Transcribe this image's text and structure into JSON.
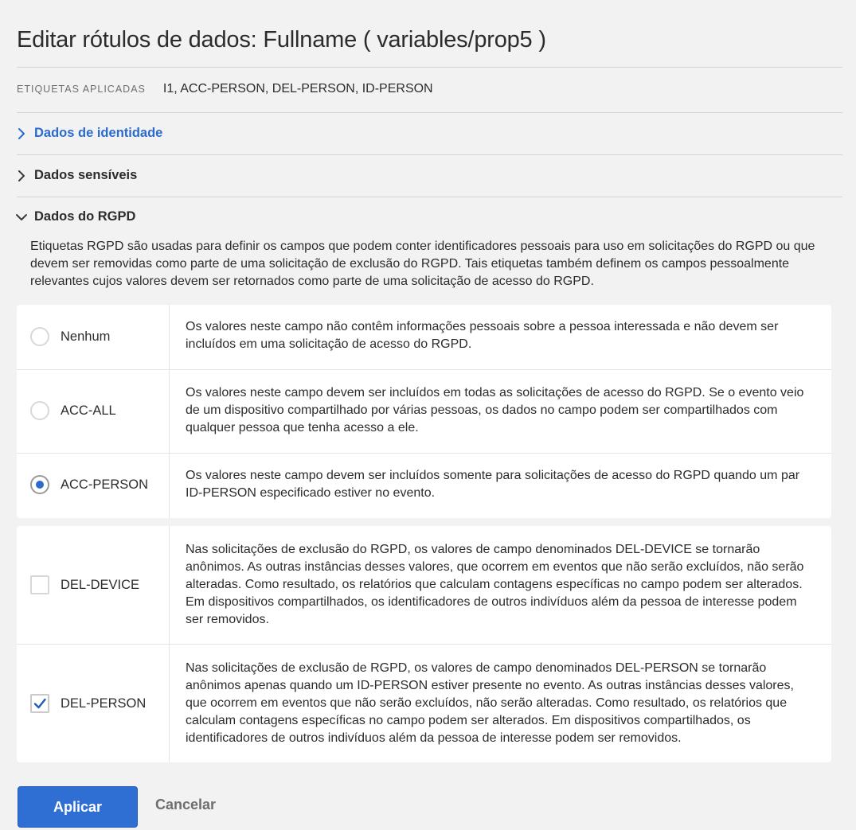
{
  "dialog": {
    "title_prefix": "Editar rótulos de dados: ",
    "title_field": "Fullname ( variables/prop5 )",
    "applied_label": "ETIQUETAS APLICADAS",
    "applied_value": "I1, ACC-PERSON, DEL-PERSON, ID-PERSON"
  },
  "sections": [
    {
      "label": "Dados de identidade",
      "expanded": false,
      "icon": "chevron-right-icon",
      "color": "#2b6bcc"
    },
    {
      "label": "Dados sensíveis",
      "expanded": false,
      "icon": "chevron-right-icon"
    },
    {
      "label": "Dados do RGPD",
      "expanded": true,
      "icon": "chevron-down-icon"
    }
  ],
  "rgpd": {
    "description": "Etiquetas RGPD são usadas para definir os campos que podem conter identificadores pessoais para uso em solicitações do RGPD ou que devem ser removidas como parte de uma solicitação de exclusão do RGPD. Tais etiquetas também definem os campos pessoalmente relevantes cujos valores devem ser retornados como parte de uma solicitação de acesso do RGPD.",
    "access_options": [
      {
        "name": "Nenhum",
        "selected": false,
        "text": "Os valores neste campo não contêm informações pessoais sobre a pessoa interessada e não devem ser incluídos em uma solicitação de acesso do RGPD."
      },
      {
        "name": "ACC-ALL",
        "selected": false,
        "text": "Os valores neste campo devem ser incluídos em todas as solicitações de acesso do RGPD. Se o evento veio de um dispositivo compartilhado por várias pessoas, os dados no campo podem ser compartilhados com qualquer pessoa que tenha acesso a ele."
      },
      {
        "name": "ACC-PERSON",
        "selected": true,
        "text": "Os valores neste campo devem ser incluídos somente para solicitações de acesso do RGPD quando um par ID-PERSON especificado estiver no evento."
      }
    ],
    "delete_options": [
      {
        "name": "DEL-DEVICE",
        "checked": false,
        "text": "Nas solicitações de exclusão do RGPD, os valores de campo denominados DEL-DEVICE se tornarão anônimos. As outras instâncias desses valores, que ocorrem em eventos que não serão excluídos, não serão alteradas. Como resultado, os relatórios que calculam contagens específicas no campo podem ser alterados. Em dispositivos compartilhados, os identificadores de outros indivíduos além da pessoa de interesse podem ser removidos."
      },
      {
        "name": "DEL-PERSON",
        "checked": true,
        "text": "Nas solicitações de exclusão de RGPD, os valores de campo denominados DEL-PERSON se tornarão anônimos apenas quando um ID-PERSON estiver presente no evento. As outras instâncias desses valores, que ocorrem em eventos que não serão excluídos, não serão alteradas. Como resultado, os relatórios que calculam contagens específicas no campo podem ser alterados. Em dispositivos compartilhados, os identificadores de outros indivíduos além da pessoa de interesse podem ser removidos."
      }
    ]
  },
  "actions": {
    "apply": "Aplicar",
    "cancel": "Cancelar"
  },
  "colors": {
    "accent": "#2f6fd3",
    "link": "#2b6bcc",
    "background": "#f2f2f2"
  }
}
